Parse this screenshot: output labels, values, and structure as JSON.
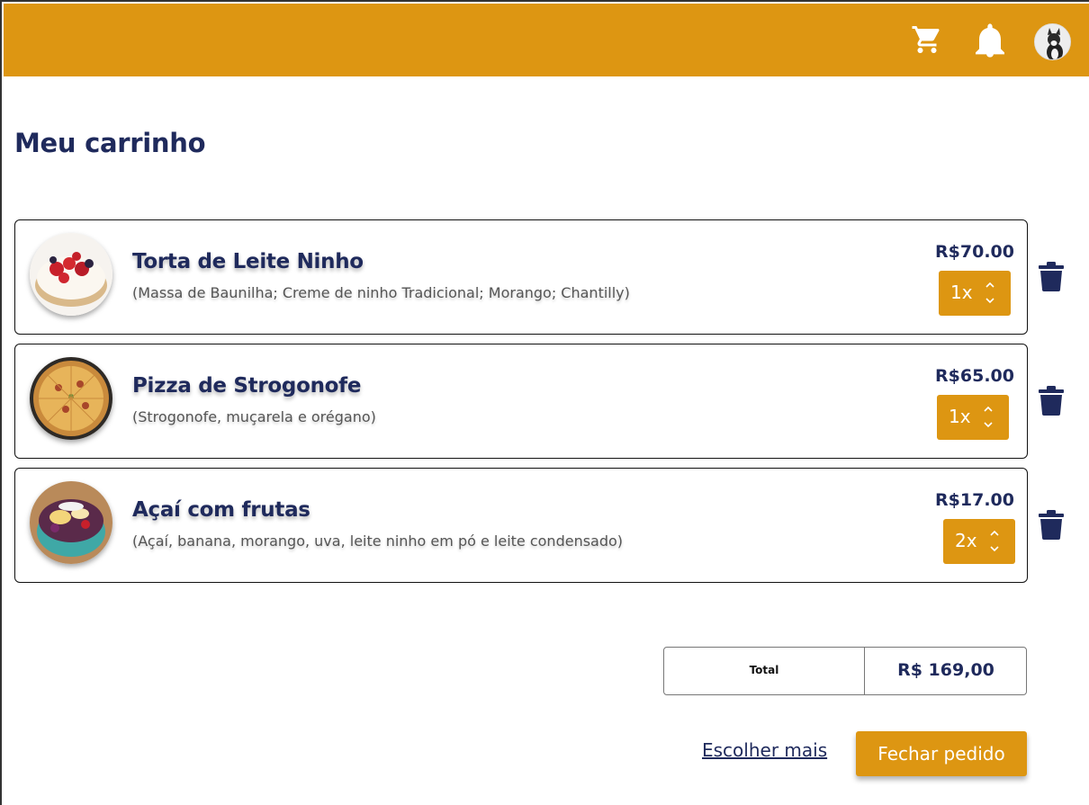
{
  "header": {
    "icons": [
      "cart-icon",
      "bell-icon",
      "avatar"
    ],
    "colors": {
      "bar": "#dd9612",
      "accent_text": "#1f2a5c"
    }
  },
  "page": {
    "title": "Meu carrinho"
  },
  "items": [
    {
      "name": "Torta de Leite Ninho",
      "description": "(Massa de Baunilha; Creme de ninho Tradicional; Morango; Chantilly)",
      "price": "R$70.00",
      "quantity": "1x"
    },
    {
      "name": "Pizza de Strogonofe",
      "description": "(Strogonofe, muçarela e orégano)",
      "price": "R$65.00",
      "quantity": "1x"
    },
    {
      "name": "Açaí com frutas",
      "description": "(Açaí, banana, morango, uva, leite ninho em pó e leite condensado)",
      "price": "R$17.00",
      "quantity": "2x"
    }
  ],
  "summary": {
    "total_label": "Total",
    "total_value": "R$ 169,00"
  },
  "actions": {
    "more_label": "Escolher mais",
    "checkout_label": "Fechar pedido"
  }
}
